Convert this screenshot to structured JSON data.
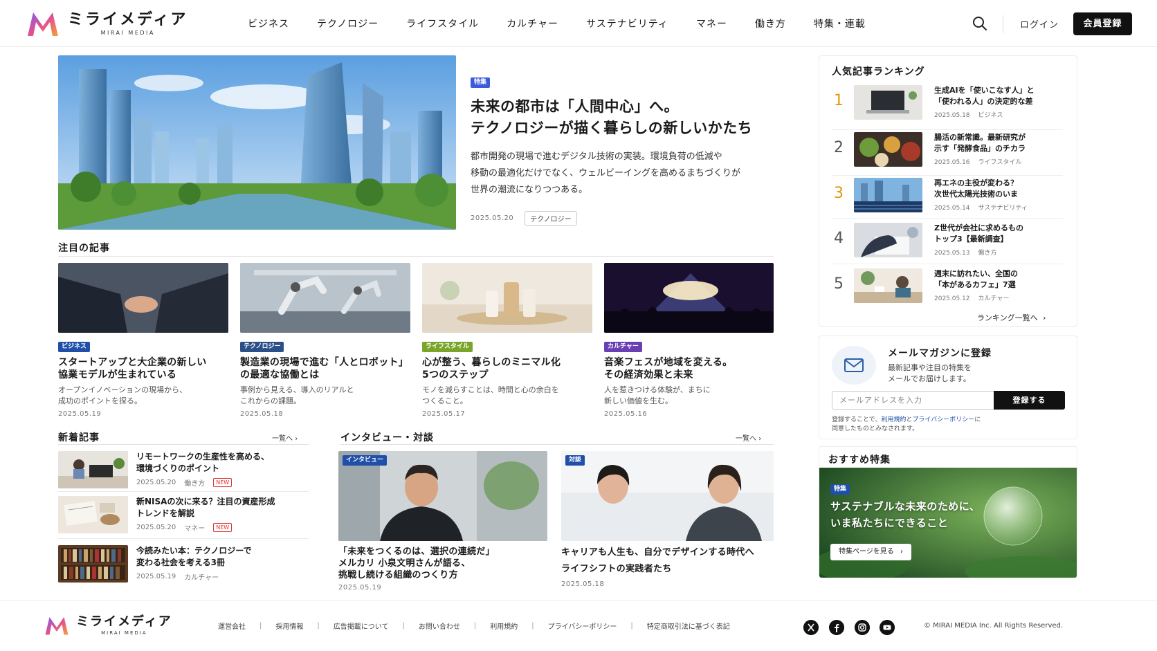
{
  "header": {
    "logo_ja": "ミライメディア",
    "logo_en": "MIRAI MEDIA",
    "nav": [
      "ビジネス",
      "テクノロジー",
      "ライフスタイル",
      "カルチャー",
      "サステナビリティ",
      "マネー",
      "働き方",
      "特集・連載"
    ],
    "login": "ログイン",
    "register": "会員登録",
    "icons": [
      "search-icon"
    ]
  },
  "hero": {
    "tag": "特集",
    "title_line1": "未来の都市は「人間中心」へ。",
    "title_line2": "テクノロジーが描く暮らしの新しいかたち",
    "desc_line1": "都市開発の現場で進むデジタル技術の実装。環境負荷の低減や",
    "desc_line2": "移動の最適化だけでなく、ウェルビーイングを高めるまちづくりが",
    "desc_line3": "世界の潮流になりつつある。",
    "date": "2025.05.20",
    "category": "テクノロジー"
  },
  "featured": {
    "title": "注目の記事",
    "cards": [
      {
        "tag": "ビジネス",
        "title1": "スタートアップと大企業の新しい",
        "title2": "協業モデルが生まれている",
        "desc1": "オープンイノベーションの現場から、",
        "desc2": "成功のポイントを探る。",
        "date": "2025.05.19"
      },
      {
        "tag": "テクノロジー",
        "title1": "製造業の現場で進む「人とロボット」",
        "title2": "の最適な協働とは",
        "desc1": "事例から見える、導入のリアルと",
        "desc2": "これからの課題。",
        "date": "2025.05.18"
      },
      {
        "tag": "ライフスタイル",
        "title1": "心が整う、暮らしのミニマル化",
        "title2": "5つのステップ",
        "desc1": "モノを減らすことは、時間と心の余白を",
        "desc2": "つくること。",
        "date": "2025.05.17"
      },
      {
        "tag": "カルチャー",
        "title1": "音楽フェスが地域を変える。",
        "title2": "その経済効果と未来",
        "desc1": "人を惹きつける体験が、まちに",
        "desc2": "新しい価値を生む。",
        "date": "2025.05.16"
      }
    ]
  },
  "new_articles": {
    "title": "新着記事",
    "more": "一覧へ",
    "items": [
      {
        "title1": "リモートワークの生産性を高める、",
        "title2": "環境づくりのポイント",
        "date": "2025.05.20",
        "category": "働き方",
        "badge": "NEW"
      },
      {
        "title1": "新NISAの次に来る？注目の資産形成",
        "title2": "トレンドを解説",
        "date": "2025.05.20",
        "category": "マネー",
        "badge": "NEW"
      },
      {
        "title1": "今読みたい本：テクノロジーで",
        "title2": "変わる社会を考える3冊",
        "date": "2025.05.19",
        "category": "カルチャー",
        "badge": ""
      }
    ]
  },
  "interviews": {
    "title": "インタビュー・対談",
    "more": "一覧へ",
    "items": [
      {
        "tag": "インタビュー",
        "title1": "「未来をつくるのは、選択の連続だ」",
        "title2": "メルカリ 小泉文明さんが語る、",
        "title3": "挑戦し続ける組織のつくり方",
        "date": "2025.05.19"
      },
      {
        "tag": "対談",
        "title1": "キャリアも人生も、自分でデザインする時代へ",
        "title2": "ライフシフトの実践者たち",
        "title3": "",
        "date": "2025.05.18"
      }
    ]
  },
  "ranking": {
    "title": "人気記事ランキング",
    "more": "ランキング一覧へ",
    "items": [
      {
        "rank": "1",
        "title1": "生成AIを「使いこなす人」と",
        "title2": "「使われる人」の決定的な差",
        "date": "2025.05.18",
        "category": "ビジネス"
      },
      {
        "rank": "2",
        "title1": "腸活の新常識。最新研究が",
        "title2": "示す「発酵食品」のチカラ",
        "date": "2025.05.16",
        "category": "ライフスタイル"
      },
      {
        "rank": "3",
        "title1": "再エネの主役が変わる？",
        "title2": "次世代太陽光技術のいま",
        "date": "2025.05.14",
        "category": "サステナビリティ"
      },
      {
        "rank": "4",
        "title1": "Z世代が会社に求めるもの",
        "title2": "トップ3【最新調査】",
        "date": "2025.05.13",
        "category": "働き方"
      },
      {
        "rank": "5",
        "title1": "週末に訪れたい、全国の",
        "title2": "「本があるカフェ」7選",
        "date": "2025.05.12",
        "category": "カルチャー"
      }
    ]
  },
  "newsletter": {
    "title": "メールマガジンに登録",
    "desc1": "最新記事や注目の特集を",
    "desc2": "メールでお届けします。",
    "placeholder": "メールアドレスを入力",
    "button": "登録する",
    "note_pre": "登録することで、",
    "note_terms": "利用規約",
    "note_and": "と",
    "note_privacy": "プライバシーポリシー",
    "note_post": "に",
    "note_line2": "同意したものとみなされます。"
  },
  "recommend": {
    "title": "おすすめ特集",
    "tag": "特集",
    "banner_line1": "サステナブルな未来のために、",
    "banner_line2": "いま私たちにできること",
    "button": "特集ページを見る"
  },
  "footer": {
    "logo_ja": "ミライメディア",
    "logo_en": "MIRAI MEDIA",
    "links": [
      "運営会社",
      "採用情報",
      "広告掲載について",
      "お問い合わせ",
      "利用規約",
      "プライバシーポリシー",
      "特定商取引法に基づく表記"
    ],
    "social_icons": [
      "x-icon",
      "facebook-icon",
      "instagram-icon",
      "youtube-icon"
    ],
    "copyright": "© MIRAI MEDIA Inc. All Rights Reserved."
  },
  "colors": {
    "accent_dark": "#111111",
    "rank_gold": "#e8950c",
    "tag_blue": "#1f4fa8",
    "tag_green": "#7aa52a",
    "tag_purple": "#6a3fb3",
    "new_badge": "#e03131"
  }
}
